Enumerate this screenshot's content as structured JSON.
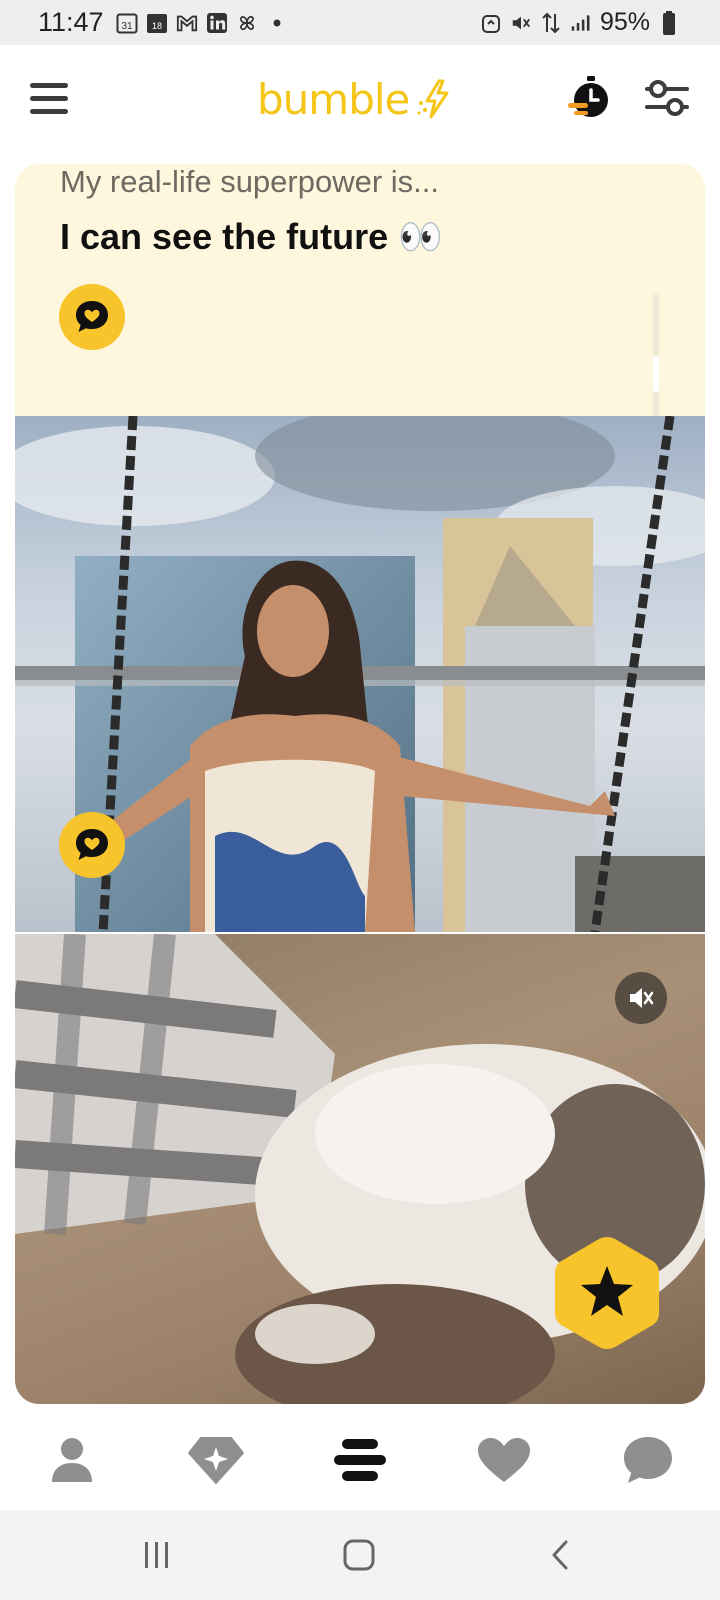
{
  "status_bar": {
    "time": "11:47",
    "battery_text": "95%",
    "left_icons": [
      "calendar-icon",
      "calendar-18-icon",
      "gmail-icon",
      "linkedin-icon",
      "pinwheel-icon",
      "dot-icon"
    ],
    "right_icons": [
      "nfc-icon",
      "mute-icon",
      "data-icon",
      "signal-icon",
      "battery-icon"
    ],
    "calendar_day": "31",
    "calendar2_day": "18"
  },
  "app_bar": {
    "logo_text": "bumble",
    "accent_color": "#f5c518"
  },
  "card": {
    "prompt_question": "My real-life superpower is...",
    "prompt_answer": "I can see the future 👀",
    "photo_alt": "Woman smiling on a rooftop swing with city skyscrapers behind",
    "video_alt": "Fluffy cat lying on a bed",
    "icons": {
      "react": "heart-chat-icon",
      "mute": "speaker-muted-icon",
      "superswipe": "star-icon"
    }
  },
  "bottom_nav": {
    "items": [
      {
        "name": "profile",
        "icon": "person-icon",
        "active": false
      },
      {
        "name": "discover",
        "icon": "sparkle-diamond-icon",
        "active": false
      },
      {
        "name": "people",
        "icon": "stack-icon",
        "active": true
      },
      {
        "name": "liked-you",
        "icon": "heart-icon",
        "active": false
      },
      {
        "name": "chats",
        "icon": "chat-bubble-icon",
        "active": false
      }
    ]
  },
  "system_nav": {
    "buttons": [
      "recent-apps-icon",
      "home-icon",
      "back-icon"
    ]
  }
}
